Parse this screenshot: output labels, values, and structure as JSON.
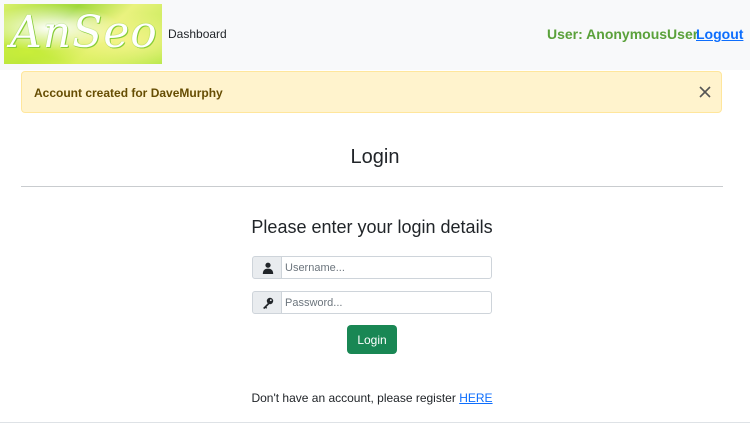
{
  "navbar": {
    "logo_text": "AnSeo",
    "dashboard_link": "Dashboard",
    "user_label": "User: AnonymousUser",
    "logout_link": "Logout"
  },
  "alert": {
    "message": "Account created for DaveMurphy",
    "close_icon": "close-icon"
  },
  "page": {
    "title": "Login",
    "subtitle": "Please enter your login details"
  },
  "form": {
    "username_placeholder": "Username...",
    "username_value": "",
    "username_icon": "user-icon",
    "password_placeholder": "Password...",
    "password_value": "",
    "password_icon": "key-icon",
    "submit_label": "Login"
  },
  "register": {
    "prompt": "Don't have an account, please register",
    "link_text": "HERE"
  },
  "colors": {
    "navbar_bg": "#f8f9fa",
    "user_label": "#5aa13a",
    "link": "#0d6efd",
    "alert_bg": "#fff3cd",
    "alert_text": "#664d03",
    "button_bg": "#198754"
  }
}
